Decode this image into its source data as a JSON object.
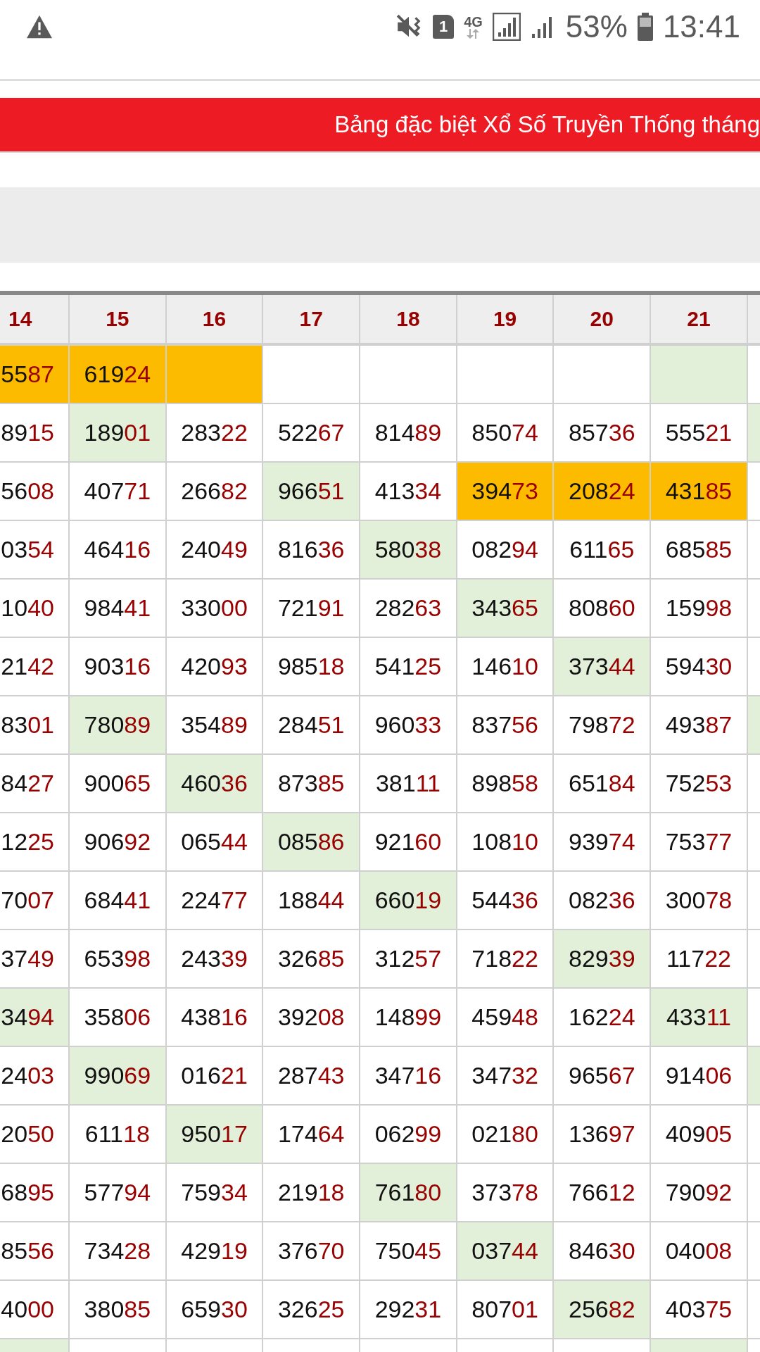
{
  "status_bar": {
    "sim_slot": "1",
    "network": "4G",
    "battery": "53%",
    "time": "13:41"
  },
  "banner": {
    "title": "Bảng đặc biệt Xổ Số Truyền Thống tháng"
  },
  "table": {
    "columns": [
      "14",
      "15",
      "16",
      "17",
      "18",
      "19",
      "20",
      "21"
    ],
    "rows": [
      {
        "cells": [
          {
            "main": "55",
            "tail": "87",
            "color": "#fdbb00"
          },
          {
            "main": "619",
            "tail": "24",
            "color": "#fdbb00"
          },
          {
            "color": "#fdbb00"
          },
          {
            "color": "#ffffff"
          },
          {
            "color": "#ffffff"
          },
          {
            "color": "#ffffff"
          },
          {
            "color": "#ffffff"
          },
          {
            "color": "#e2f0d9"
          },
          {
            "color": "#ffffff"
          }
        ]
      },
      {
        "cells": [
          {
            "main": "89",
            "tail": "15",
            "color": "#ffffff"
          },
          {
            "main": "189",
            "tail": "01",
            "color": "#e2f0d9"
          },
          {
            "main": "283",
            "tail": "22",
            "color": "#ffffff"
          },
          {
            "main": "522",
            "tail": "67",
            "color": "#ffffff"
          },
          {
            "main": "814",
            "tail": "89",
            "color": "#ffffff"
          },
          {
            "main": "850",
            "tail": "74",
            "color": "#ffffff"
          },
          {
            "main": "857",
            "tail": "36",
            "color": "#ffffff"
          },
          {
            "main": "555",
            "tail": "21",
            "color": "#ffffff"
          },
          {
            "color": "#e2f0d9"
          }
        ]
      },
      {
        "cells": [
          {
            "main": "56",
            "tail": "08",
            "color": "#ffffff"
          },
          {
            "main": "407",
            "tail": "71",
            "color": "#ffffff"
          },
          {
            "main": "266",
            "tail": "82",
            "color": "#ffffff"
          },
          {
            "main": "966",
            "tail": "51",
            "color": "#e2f0d9"
          },
          {
            "main": "413",
            "tail": "34",
            "color": "#ffffff"
          },
          {
            "main": "394",
            "tail": "73",
            "color": "#fdbb00"
          },
          {
            "main": "208",
            "tail": "24",
            "color": "#fdbb00"
          },
          {
            "main": "431",
            "tail": "85",
            "color": "#fdbb00"
          },
          {
            "color": "#ffffff"
          }
        ]
      },
      {
        "cells": [
          {
            "main": "03",
            "tail": "54",
            "color": "#ffffff"
          },
          {
            "main": "464",
            "tail": "16",
            "color": "#ffffff"
          },
          {
            "main": "240",
            "tail": "49",
            "color": "#ffffff"
          },
          {
            "main": "816",
            "tail": "36",
            "color": "#ffffff"
          },
          {
            "main": "580",
            "tail": "38",
            "color": "#e2f0d9"
          },
          {
            "main": "082",
            "tail": "94",
            "color": "#ffffff"
          },
          {
            "main": "611",
            "tail": "65",
            "color": "#ffffff"
          },
          {
            "main": "685",
            "tail": "85",
            "color": "#ffffff"
          },
          {
            "color": "#ffffff"
          }
        ]
      },
      {
        "cells": [
          {
            "main": "10",
            "tail": "40",
            "color": "#ffffff"
          },
          {
            "main": "984",
            "tail": "41",
            "color": "#ffffff"
          },
          {
            "main": "330",
            "tail": "00",
            "color": "#ffffff"
          },
          {
            "main": "721",
            "tail": "91",
            "color": "#ffffff"
          },
          {
            "main": "282",
            "tail": "63",
            "color": "#ffffff"
          },
          {
            "main": "343",
            "tail": "65",
            "color": "#e2f0d9"
          },
          {
            "main": "808",
            "tail": "60",
            "color": "#ffffff"
          },
          {
            "main": "159",
            "tail": "98",
            "color": "#ffffff"
          },
          {
            "color": "#ffffff"
          }
        ]
      },
      {
        "cells": [
          {
            "main": "21",
            "tail": "42",
            "color": "#ffffff"
          },
          {
            "main": "903",
            "tail": "16",
            "color": "#ffffff"
          },
          {
            "main": "420",
            "tail": "93",
            "color": "#ffffff"
          },
          {
            "main": "985",
            "tail": "18",
            "color": "#ffffff"
          },
          {
            "main": "541",
            "tail": "25",
            "color": "#ffffff"
          },
          {
            "main": "146",
            "tail": "10",
            "color": "#ffffff"
          },
          {
            "main": "373",
            "tail": "44",
            "color": "#e2f0d9"
          },
          {
            "main": "594",
            "tail": "30",
            "color": "#ffffff"
          },
          {
            "color": "#ffffff"
          }
        ]
      },
      {
        "cells": [
          {
            "main": "83",
            "tail": "01",
            "color": "#ffffff"
          },
          {
            "main": "780",
            "tail": "89",
            "color": "#e2f0d9"
          },
          {
            "main": "354",
            "tail": "89",
            "color": "#ffffff"
          },
          {
            "main": "284",
            "tail": "51",
            "color": "#ffffff"
          },
          {
            "main": "960",
            "tail": "33",
            "color": "#ffffff"
          },
          {
            "main": "837",
            "tail": "56",
            "color": "#ffffff"
          },
          {
            "main": "798",
            "tail": "72",
            "color": "#ffffff"
          },
          {
            "main": "493",
            "tail": "87",
            "color": "#ffffff"
          },
          {
            "color": "#e2f0d9"
          }
        ]
      },
      {
        "cells": [
          {
            "main": "84",
            "tail": "27",
            "color": "#ffffff"
          },
          {
            "main": "900",
            "tail": "65",
            "color": "#ffffff"
          },
          {
            "main": "460",
            "tail": "36",
            "color": "#e2f0d9"
          },
          {
            "main": "873",
            "tail": "85",
            "color": "#ffffff"
          },
          {
            "main": "381",
            "tail": "11",
            "color": "#ffffff"
          },
          {
            "main": "898",
            "tail": "58",
            "color": "#ffffff"
          },
          {
            "main": "651",
            "tail": "84",
            "color": "#ffffff"
          },
          {
            "main": "752",
            "tail": "53",
            "color": "#ffffff"
          },
          {
            "color": "#ffffff"
          }
        ]
      },
      {
        "cells": [
          {
            "main": "12",
            "tail": "25",
            "color": "#ffffff"
          },
          {
            "main": "906",
            "tail": "92",
            "color": "#ffffff"
          },
          {
            "main": "065",
            "tail": "44",
            "color": "#ffffff"
          },
          {
            "main": "085",
            "tail": "86",
            "color": "#e2f0d9"
          },
          {
            "main": "921",
            "tail": "60",
            "color": "#ffffff"
          },
          {
            "main": "108",
            "tail": "10",
            "color": "#ffffff"
          },
          {
            "main": "939",
            "tail": "74",
            "color": "#ffffff"
          },
          {
            "main": "753",
            "tail": "77",
            "color": "#ffffff"
          },
          {
            "color": "#ffffff"
          }
        ]
      },
      {
        "cells": [
          {
            "main": "70",
            "tail": "07",
            "color": "#ffffff"
          },
          {
            "main": "684",
            "tail": "41",
            "color": "#ffffff"
          },
          {
            "main": "224",
            "tail": "77",
            "color": "#ffffff"
          },
          {
            "main": "188",
            "tail": "44",
            "color": "#ffffff"
          },
          {
            "main": "660",
            "tail": "19",
            "color": "#e2f0d9"
          },
          {
            "main": "544",
            "tail": "36",
            "color": "#ffffff"
          },
          {
            "main": "082",
            "tail": "36",
            "color": "#ffffff"
          },
          {
            "main": "300",
            "tail": "78",
            "color": "#ffffff"
          },
          {
            "color": "#ffffff"
          }
        ]
      },
      {
        "cells": [
          {
            "main": "37",
            "tail": "49",
            "color": "#ffffff"
          },
          {
            "main": "653",
            "tail": "98",
            "color": "#ffffff"
          },
          {
            "main": "243",
            "tail": "39",
            "color": "#ffffff"
          },
          {
            "main": "326",
            "tail": "85",
            "color": "#ffffff"
          },
          {
            "main": "312",
            "tail": "57",
            "color": "#ffffff"
          },
          {
            "main": "718",
            "tail": "22",
            "color": "#ffffff"
          },
          {
            "main": "829",
            "tail": "39",
            "color": "#e2f0d9"
          },
          {
            "main": "117",
            "tail": "22",
            "color": "#ffffff"
          },
          {
            "color": "#ffffff"
          }
        ]
      },
      {
        "cells": [
          {
            "main": "34",
            "tail": "94",
            "color": "#e2f0d9"
          },
          {
            "main": "358",
            "tail": "06",
            "color": "#ffffff"
          },
          {
            "main": "438",
            "tail": "16",
            "color": "#ffffff"
          },
          {
            "main": "392",
            "tail": "08",
            "color": "#ffffff"
          },
          {
            "main": "148",
            "tail": "99",
            "color": "#ffffff"
          },
          {
            "main": "459",
            "tail": "48",
            "color": "#ffffff"
          },
          {
            "main": "162",
            "tail": "24",
            "color": "#ffffff"
          },
          {
            "main": "433",
            "tail": "11",
            "color": "#e2f0d9"
          },
          {
            "color": "#ffffff"
          }
        ]
      },
      {
        "cells": [
          {
            "main": "24",
            "tail": "03",
            "color": "#ffffff"
          },
          {
            "main": "990",
            "tail": "69",
            "color": "#e2f0d9"
          },
          {
            "main": "016",
            "tail": "21",
            "color": "#ffffff"
          },
          {
            "main": "287",
            "tail": "43",
            "color": "#ffffff"
          },
          {
            "main": "347",
            "tail": "16",
            "color": "#ffffff"
          },
          {
            "main": "347",
            "tail": "32",
            "color": "#ffffff"
          },
          {
            "main": "965",
            "tail": "67",
            "color": "#ffffff"
          },
          {
            "main": "914",
            "tail": "06",
            "color": "#ffffff"
          },
          {
            "color": "#e2f0d9"
          }
        ]
      },
      {
        "cells": [
          {
            "main": "20",
            "tail": "50",
            "color": "#ffffff"
          },
          {
            "main": "611",
            "tail": "18",
            "color": "#ffffff"
          },
          {
            "main": "950",
            "tail": "17",
            "color": "#e2f0d9"
          },
          {
            "main": "174",
            "tail": "64",
            "color": "#ffffff"
          },
          {
            "main": "062",
            "tail": "99",
            "color": "#ffffff"
          },
          {
            "main": "021",
            "tail": "80",
            "color": "#ffffff"
          },
          {
            "main": "136",
            "tail": "97",
            "color": "#ffffff"
          },
          {
            "main": "409",
            "tail": "05",
            "color": "#ffffff"
          },
          {
            "color": "#ffffff"
          }
        ]
      },
      {
        "cells": [
          {
            "main": "68",
            "tail": "95",
            "color": "#ffffff"
          },
          {
            "main": "577",
            "tail": "94",
            "color": "#ffffff"
          },
          {
            "main": "759",
            "tail": "34",
            "color": "#ffffff"
          },
          {
            "main": "219",
            "tail": "18",
            "color": "#ffffff"
          },
          {
            "main": "761",
            "tail": "80",
            "color": "#e2f0d9"
          },
          {
            "main": "373",
            "tail": "78",
            "color": "#ffffff"
          },
          {
            "main": "766",
            "tail": "12",
            "color": "#ffffff"
          },
          {
            "main": "790",
            "tail": "92",
            "color": "#ffffff"
          },
          {
            "color": "#ffffff"
          }
        ]
      },
      {
        "cells": [
          {
            "main": "85",
            "tail": "56",
            "color": "#ffffff"
          },
          {
            "main": "734",
            "tail": "28",
            "color": "#ffffff"
          },
          {
            "main": "429",
            "tail": "19",
            "color": "#ffffff"
          },
          {
            "main": "376",
            "tail": "70",
            "color": "#ffffff"
          },
          {
            "main": "750",
            "tail": "45",
            "color": "#ffffff"
          },
          {
            "main": "037",
            "tail": "44",
            "color": "#e2f0d9"
          },
          {
            "main": "846",
            "tail": "30",
            "color": "#ffffff"
          },
          {
            "main": "040",
            "tail": "08",
            "color": "#ffffff"
          },
          {
            "color": "#ffffff"
          }
        ]
      },
      {
        "cells": [
          {
            "main": "40",
            "tail": "00",
            "color": "#ffffff"
          },
          {
            "main": "380",
            "tail": "85",
            "color": "#ffffff"
          },
          {
            "main": "659",
            "tail": "30",
            "color": "#ffffff"
          },
          {
            "main": "326",
            "tail": "25",
            "color": "#ffffff"
          },
          {
            "main": "292",
            "tail": "31",
            "color": "#ffffff"
          },
          {
            "main": "807",
            "tail": "01",
            "color": "#ffffff"
          },
          {
            "main": "256",
            "tail": "82",
            "color": "#e2f0d9"
          },
          {
            "main": "403",
            "tail": "75",
            "color": "#ffffff"
          },
          {
            "color": "#ffffff"
          }
        ]
      },
      {
        "cells": [
          {
            "color": "#e2f0d9"
          },
          {
            "color": "#ffffff"
          },
          {
            "color": "#ffffff"
          },
          {
            "color": "#ffffff"
          },
          {
            "color": "#ffffff"
          },
          {
            "color": "#ffffff"
          },
          {
            "color": "#ffffff"
          },
          {
            "color": "#e2f0d9"
          }
        ]
      }
    ]
  }
}
